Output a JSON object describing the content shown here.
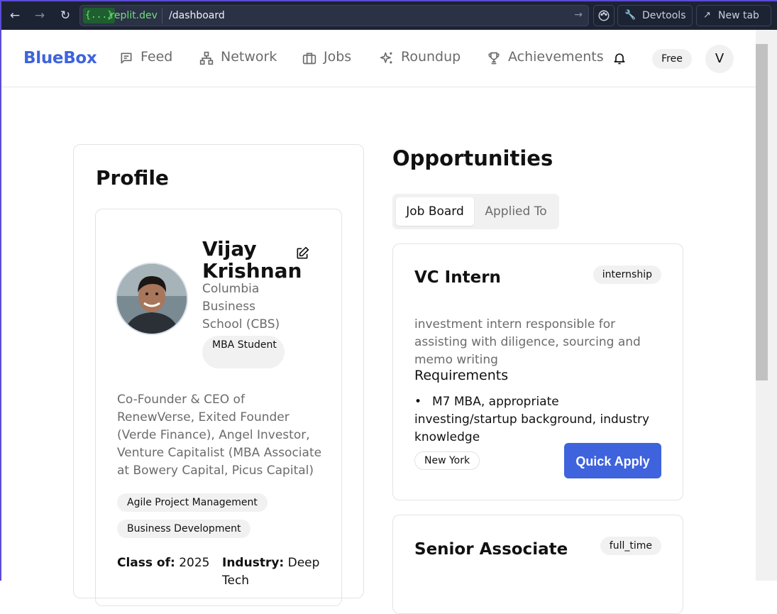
{
  "browser": {
    "domain_prefix": "{...}",
    "domain": ".replit.dev",
    "path": "/dashboard",
    "devtools_label": "Devtools",
    "newtab_label": "New tab"
  },
  "header": {
    "logo": "BlueBox",
    "nav": [
      {
        "label": "Feed",
        "icon": "message-square-icon"
      },
      {
        "label": "Network",
        "icon": "network-icon"
      },
      {
        "label": "Jobs",
        "icon": "briefcase-icon"
      },
      {
        "label": "Roundup",
        "icon": "sparkles-icon"
      },
      {
        "label": "Achievements",
        "icon": "trophy-icon"
      }
    ],
    "plan": "Free",
    "avatar_initial": "V"
  },
  "profile": {
    "title": "Profile",
    "name": "Vijay Krishnan",
    "school": "Columbia Business School (CBS)",
    "role": "MBA Student",
    "bio": "Co-Founder & CEO of RenewVerse, Exited Founder (Verde Finance), Angel Investor, Venture Capitalist (MBA Associate at Bowery Capital, Picus Capital)",
    "skills": [
      "Agile Project Management",
      "Business Development"
    ],
    "class_label": "Class of:",
    "class_value": "2025",
    "industry_label": "Industry:",
    "industry_value": "Deep Tech"
  },
  "opportunities": {
    "title": "Opportunities",
    "tabs": [
      "Job Board",
      "Applied To"
    ],
    "active_tab": "Job Board",
    "jobs": [
      {
        "title": "VC Intern",
        "type": "internship",
        "description": "investment intern responsible for assisting with diligence, sourcing and memo writing",
        "requirements_heading": "Requirements",
        "requirements": [
          "M7 MBA, appropriate investing/startup background, industry knowledge"
        ],
        "location": "New York",
        "apply_label": "Quick Apply"
      },
      {
        "title": "Senior Associate",
        "type": "full_time"
      }
    ]
  },
  "colors": {
    "brand": "#3e63dd",
    "chrome_bg": "#1c2333",
    "domain_green": "#6ee07b"
  }
}
